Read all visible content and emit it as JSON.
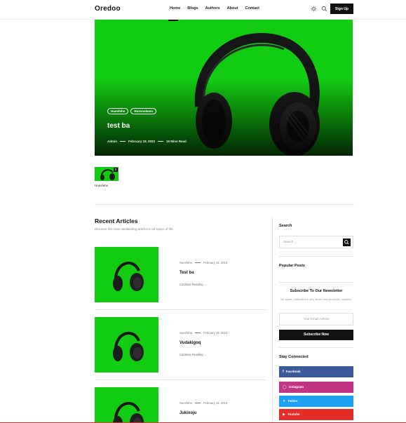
{
  "header": {
    "logo": "Oredoo",
    "nav": [
      "Home",
      "Blogs",
      "Authors",
      "About",
      "Contact"
    ],
    "signup_label": "Sign Up",
    "icons": [
      "theme-toggle-icon",
      "search-icon"
    ]
  },
  "hero": {
    "tags": [
      "Huesfehe",
      "Nuzonolsem"
    ],
    "title": "test ba",
    "author": "Admin",
    "date": "February 19, 2023",
    "read_time": "15 Mins Read",
    "image_bg": "#12cc12"
  },
  "thumb": {
    "label": "Huesfehe",
    "close_glyph": "x"
  },
  "recent": {
    "title": "Recent Articles",
    "subtitle": "Discover the most outstanding articles in all topics of life.",
    "articles": [
      {
        "category": "Huesfehe",
        "date": "February 19, 2023",
        "title": "Test ba",
        "more": "Continue Reading"
      },
      {
        "category": "Huesfehe",
        "date": "February 19, 2023",
        "title": "Vudakigoq",
        "more": "Continue Reading"
      },
      {
        "category": "Huesfehe",
        "date": "February 19, 2023",
        "title": "Jukixoju",
        "more": "Continue Reading"
      }
    ]
  },
  "sidebar": {
    "search_title": "Search",
    "search_placeholder": "Search ...",
    "popular_title": "Popular Posts",
    "newsletter_title": "Subscribe To Our Newsletter",
    "newsletter_sub": "No spam, notifications only about new products, updates.",
    "email_placeholder": "Your Email Adress",
    "subscribe_label": "Subscribe Now",
    "social_title": "Stay Connected",
    "social": [
      {
        "name": "Facebook",
        "color": "#3b5998",
        "icon": "facebook-icon"
      },
      {
        "name": "Instagram",
        "color": "#c13584",
        "icon": "instagram-icon"
      },
      {
        "name": "Twitter",
        "color": "#1da1f2",
        "icon": "twitter-icon"
      },
      {
        "name": "Youtube",
        "color": "#e52d27",
        "icon": "youtube-icon"
      }
    ]
  },
  "colors": {
    "accent": "#12cc12",
    "dark": "#111111"
  }
}
